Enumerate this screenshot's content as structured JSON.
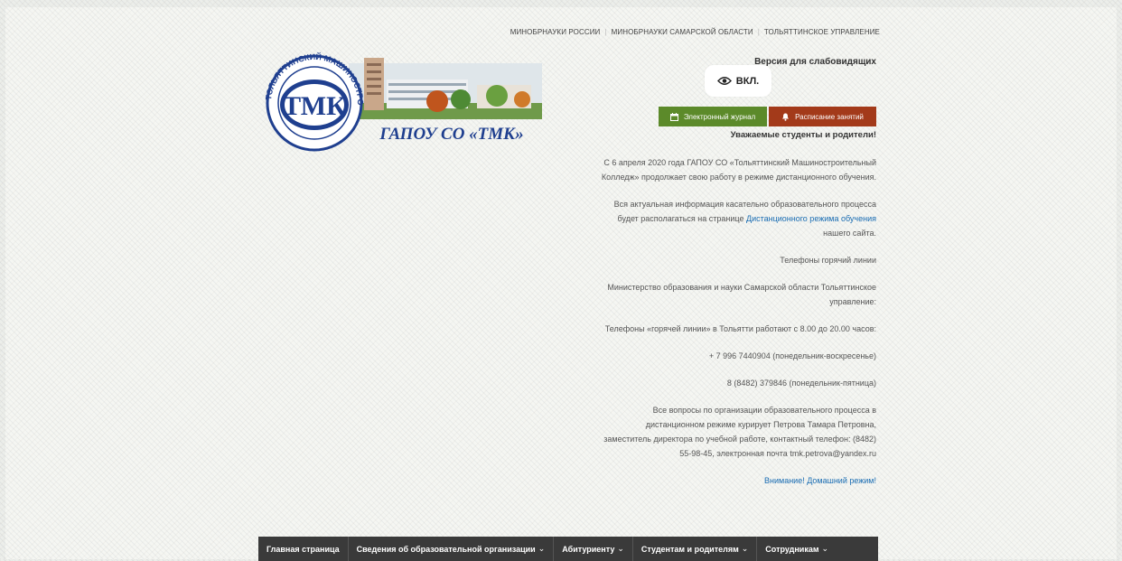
{
  "top_links": [
    "МИНОБРНАУКИ РОССИИ",
    "МИНОБРНАУКИ САМАРСКОЙ ОБЛАСТИ",
    "ТОЛЬЯТТИНСКОЕ УПРАВЛЕНИЕ"
  ],
  "vision": {
    "title": "Версия для слабовидящих",
    "toggle_label": "ВКЛ."
  },
  "logo": {
    "abbr": "ТМК",
    "ring_text": "ТОЛЬЯТТИНСКИЙ МАШИНОСТРОИТЕЛЬНЫЙ КОЛЛЕДЖ",
    "caption": "ГАПОУ СО «ТМК»"
  },
  "buttons": {
    "journal": "Электронный журнал",
    "schedule": "Расписание занятий"
  },
  "notice": {
    "heading": "Уважаемые студенты и родители!",
    "p1": "С 6 апреля 2020 года ГАПОУ СО «Тольяттинский Машиностроительный  Колледж» продолжает свою работу в режиме дистанционного обучения.",
    "p2_before": "Вся актуальная информация касательно образовательного процесса будет располагаться на странице ",
    "p2_link": "Дистанционного режима обучения",
    "p2_after": " нашего сайта.",
    "p3": "Телефоны горячий линии",
    "p4": "Министерство образования и науки Самарской области Тольяттинское управление:",
    "p5": "Телефоны «горячей линии» в Тольятти работают с 8.00 до 20.00 часов:",
    "p6": "+ 7 996 7440904  (понедельник-воскресенье)",
    "p7": "8 (8482) 379846   (понедельник-пятница)",
    "p8": "Все вопросы по организации образовательного процесса в дистанционном режиме курирует Петрова Тамара Петровна, заместитель директора по учебной работе, контактный телефон: (8482) 55-98-45, электронная почта tmk.petrova@yandex.ru",
    "p9_link": "Внимание! Домашний режим!"
  },
  "nav": [
    {
      "label": "Главная страница",
      "has_dropdown": false
    },
    {
      "label": "Сведения об образовательной организации",
      "has_dropdown": true
    },
    {
      "label": "Абитуриенту",
      "has_dropdown": true
    },
    {
      "label": "Студентам и родителям",
      "has_dropdown": true
    },
    {
      "label": "Сотрудникам",
      "has_dropdown": true
    }
  ],
  "colors": {
    "journal_bg": "#5c8a2a",
    "schedule_bg": "#a33a1a",
    "nav_bg": "#3a3a3a",
    "link": "#1a6db3",
    "logo_blue": "#1f3f8f"
  },
  "icons": {
    "vision": "eye-icon",
    "journal": "calendar-icon",
    "schedule": "bell-icon",
    "dropdown": "chevron-down-icon"
  }
}
